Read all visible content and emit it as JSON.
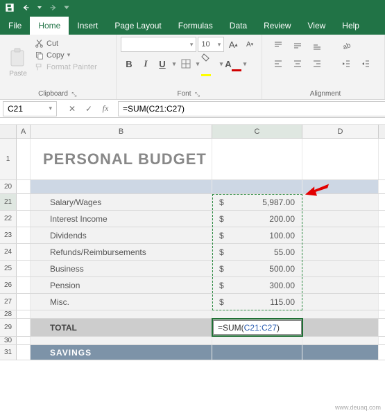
{
  "qat": {
    "save": "Save",
    "undo": "Undo",
    "redo": "Redo"
  },
  "tabs": {
    "file": "File",
    "home": "Home",
    "insert": "Insert",
    "pagelayout": "Page Layout",
    "formulas": "Formulas",
    "data": "Data",
    "review": "Review",
    "view": "View",
    "help": "Help"
  },
  "ribbon": {
    "clipboard": {
      "paste": "Paste",
      "cut": "Cut",
      "copy": "Copy",
      "painter": "Format Painter",
      "label": "Clipboard"
    },
    "font": {
      "label": "Font",
      "size": "10",
      "inc": "A",
      "dec": "A",
      "bold": "B",
      "italic": "I",
      "underline": "U"
    },
    "alignment": {
      "label": "Alignment"
    }
  },
  "formula_bar": {
    "name": "C21",
    "cancel": "✕",
    "enter": "✓",
    "fx": "fx",
    "formula": "=SUM(C21:C27)"
  },
  "columns": {
    "a": "A",
    "b": "B",
    "c": "C",
    "d": "D"
  },
  "rows": {
    "r1": "1",
    "r20": "20",
    "r21": "21",
    "r22": "22",
    "r23": "23",
    "r24": "24",
    "r25": "25",
    "r26": "26",
    "r27": "27",
    "r28": "28",
    "r29": "29",
    "r30": "30",
    "r31": "31"
  },
  "sheet": {
    "title": "PERSONAL BUDGET",
    "items": [
      {
        "label": "Salary/Wages",
        "value": "5,987.00"
      },
      {
        "label": "Interest Income",
        "value": "200.00"
      },
      {
        "label": "Dividends",
        "value": "100.00"
      },
      {
        "label": "Refunds/Reimbursements",
        "value": "55.00"
      },
      {
        "label": "Business",
        "value": "500.00"
      },
      {
        "label": "Pension",
        "value": "300.00"
      },
      {
        "label": "Misc.",
        "value": "115.00"
      }
    ],
    "currency": "$",
    "total_label": "TOTAL",
    "total_formula_prefix": "=SUM(",
    "total_formula_ref": "C21:C27",
    "total_formula_suffix": ")",
    "savings": "SAVINGS"
  },
  "watermark": "www.deuaq.com"
}
